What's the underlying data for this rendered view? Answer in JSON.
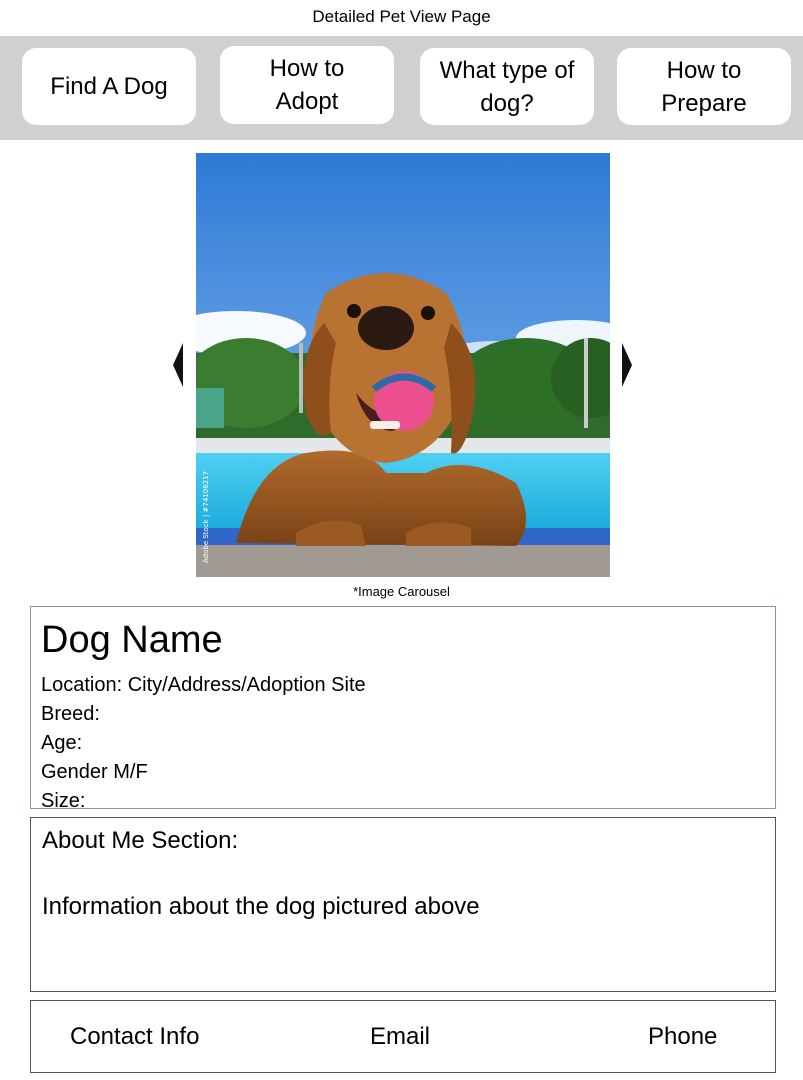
{
  "page": {
    "title": "Detailed Pet View Page"
  },
  "nav": {
    "items": [
      {
        "label": "Find A Dog"
      },
      {
        "label": "How to\nAdopt"
      },
      {
        "label": "What type of\ndog?"
      },
      {
        "label": "How to\nPrepare"
      }
    ]
  },
  "carousel": {
    "caption": "*Image Carousel",
    "watermark": "Adobe Stock | #74106217",
    "prev_icon": "chevron-left-icon",
    "next_icon": "chevron-right-icon"
  },
  "pet": {
    "name": "Dog Name",
    "location": "Location: City/Address/Adoption Site",
    "breed": "Breed:",
    "age": "Age:",
    "gender": "Gender M/F",
    "size": "Size:"
  },
  "about": {
    "heading": "About Me Section:",
    "text": "Information about the dog pictured above"
  },
  "contact": {
    "label": "Contact Info",
    "email": "Email",
    "phone": "Phone"
  },
  "colors": {
    "nav_background": "#d0d0d0",
    "info_border": "#8496b0",
    "box_border": "#555555"
  }
}
